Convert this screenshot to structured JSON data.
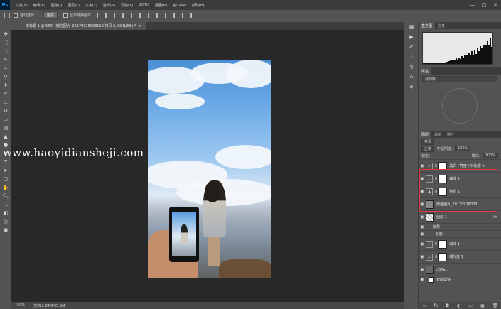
{
  "app": {
    "logo": "Ps"
  },
  "menu": [
    "文件(F)",
    "编辑(E)",
    "图像(I)",
    "图层(L)",
    "文字(Y)",
    "选择(S)",
    "滤镜(T)",
    "3D(D)",
    "视图(V)",
    "窗口(W)",
    "帮助(H)"
  ],
  "window_controls": {
    "minimize": "—",
    "maximize": "□",
    "close": "✕"
  },
  "options": {
    "auto_select_label": "自动选择：",
    "auto_select_value": "图层",
    "transform_label": "显示变换控件"
  },
  "document": {
    "tab_title": "未标题-1 @ 50% (微信图片_20170926003110 拷贝 2, RGB/8#) *",
    "tab_close": "×"
  },
  "watermark": "www.haoyidiansheji.com",
  "status": {
    "zoom": "50%",
    "doc_info": "文档:2.64M/35.5M"
  },
  "panels": {
    "histogram_tabs": [
      "直方图",
      "信息"
    ],
    "properties_tabs": [
      "属性"
    ],
    "preset": "预设",
    "preset_value": "我的库",
    "layers_tabs": [
      "图层",
      "通道",
      "路径"
    ],
    "filter_label": "类型",
    "blend_mode": "正常",
    "opacity_label": "不透明度：",
    "opacity_value": "100%",
    "lock_label": "锁定：",
    "fill_label": "填充：",
    "fill_value": "100%"
  },
  "layers": [
    {
      "name": "黑白 / 亮度 / 对比度 1",
      "type": "adjustment",
      "icon": "☀"
    },
    {
      "name": "曲线 2",
      "type": "adjustment",
      "icon": "⌇"
    },
    {
      "name": "色阶 1",
      "type": "adjustment",
      "icon": "▲"
    },
    {
      "name": "微信图片_20170926003...",
      "type": "image",
      "icon": ""
    },
    {
      "name": "图层 1",
      "type": "image",
      "icon": "",
      "fx": "fx"
    },
    {
      "name": "效果",
      "type": "sub"
    },
    {
      "name": "投影",
      "type": "sub"
    },
    {
      "name": "曲线 1",
      "type": "adjustment",
      "icon": "⌇"
    },
    {
      "name": "曝光度 1",
      "type": "adjustment",
      "icon": "±"
    },
    {
      "name": "d57a...",
      "type": "image",
      "icon": ""
    },
    {
      "name": "智能滤镜",
      "type": "sub"
    }
  ],
  "colors": {
    "accent": "#31a8ff",
    "highlight_box": "#e23a3a"
  }
}
